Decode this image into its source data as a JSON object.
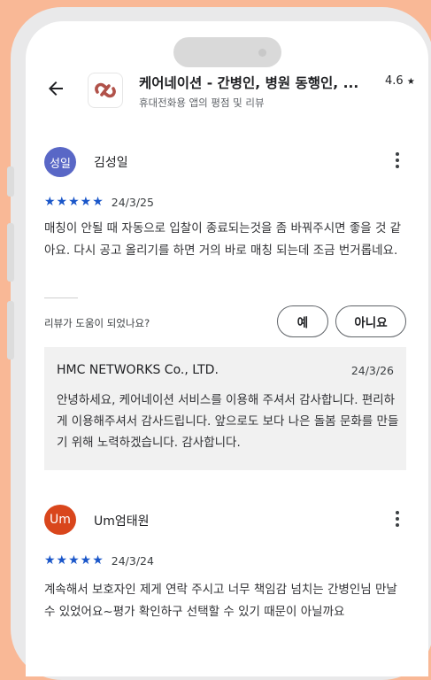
{
  "header": {
    "title": "케어네이션 - 간병인, 병원 동행인, ...",
    "rating": "4.6",
    "rating_star": "★",
    "subtitle": "휴대전화용 앱의 평점 및 리뷰"
  },
  "icons": {
    "back": "arrow-left-icon",
    "app": "carenation-logo-icon",
    "more": "more-vertical-icon",
    "star": "star-icon"
  },
  "colors": {
    "background": "#f9b896",
    "star": "#1a56c9",
    "avatar1": "#5967c6",
    "avatar2": "#d9461c",
    "brand": "#b1524a"
  },
  "reviews": [
    {
      "avatar_text": "성일",
      "name": "김성일",
      "stars": "★★★★★",
      "rating": 5,
      "date": "24/3/25",
      "text": "매칭이 안될 때 자동으로 입찰이 종료되는것을 좀 바꿔주시면 좋을 것 같아요. 다시 공고 올리기를 하면 거의 바로 매칭 되는데 조금 번거롭네요.",
      "helpful_question": "리뷰가 도움이 되었나요?",
      "yes_label": "예",
      "no_label": "아니요",
      "reply": {
        "author": "HMC NETWORKS Co., LTD.",
        "date": "24/3/26",
        "text": "안녕하세요, 케어네이션 서비스를 이용해 주셔서 감사합니다. 편리하게 이용해주셔서 감사드립니다. 앞으로도 보다 나은 돌봄 문화를 만들기 위해 노력하겠습니다. 감사합니다."
      }
    },
    {
      "avatar_text": "Um",
      "name": "Um엄태원",
      "stars": "★★★★★",
      "rating": 5,
      "date": "24/3/24",
      "text": "계속해서 보호자인 제게 연락 주시고 너무 책임감 넘치는 간병인님 만날 수 있었어요~평가 확인하구 선택할 수 있기 때문이 아닐까요"
    }
  ]
}
